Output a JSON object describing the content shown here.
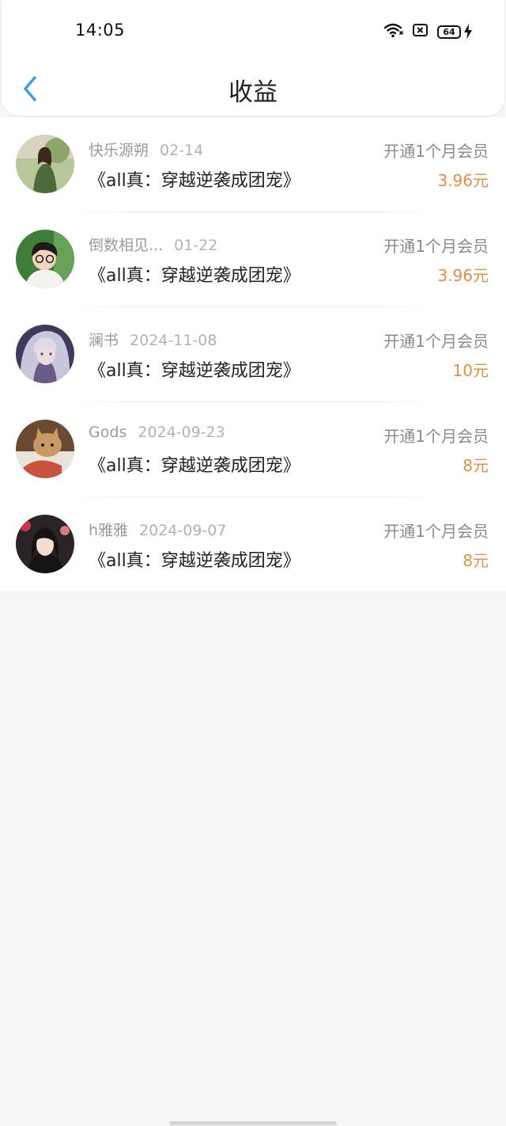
{
  "status_bar": {
    "time": "14:05",
    "battery_level": "64"
  },
  "header": {
    "title": "收益"
  },
  "colors": {
    "accent_blue": "#3a9be8",
    "amount_orange": "#e58c45"
  },
  "records": [
    {
      "user": "快乐源朔",
      "date": "02-14",
      "book": "《all真：穿越逆袭成团宠》",
      "type": "开通1个月会员",
      "amount": "3.96元"
    },
    {
      "user": "倒数相见...",
      "date": "01-22",
      "book": "《all真：穿越逆袭成团宠》",
      "type": "开通1个月会员",
      "amount": "3.96元"
    },
    {
      "user": "澜书",
      "date": "2024-11-08",
      "book": "《all真：穿越逆袭成团宠》",
      "type": "开通1个月会员",
      "amount": "10元"
    },
    {
      "user": "Gods",
      "date": "2024-09-23",
      "book": "《all真：穿越逆袭成团宠》",
      "type": "开通1个月会员",
      "amount": "8元"
    },
    {
      "user": "h雅雅",
      "date": "2024-09-07",
      "book": "《all真：穿越逆袭成团宠》",
      "type": "开通1个月会员",
      "amount": "8元"
    }
  ]
}
